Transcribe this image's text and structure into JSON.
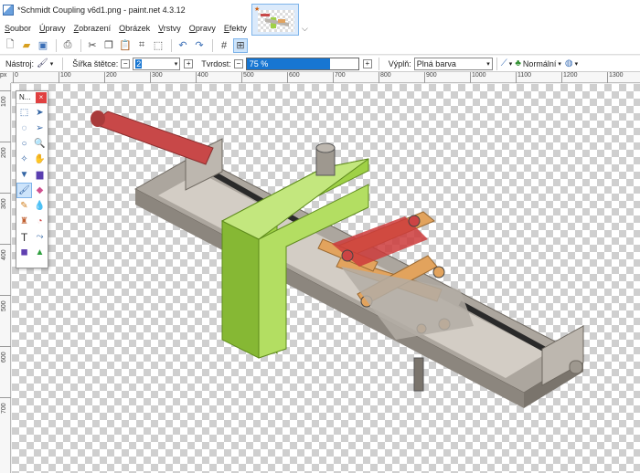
{
  "window": {
    "title": "*Schmidt Coupling v6d1.png - paint.net 4.3.12"
  },
  "menu": [
    {
      "label": "Soubor",
      "accel": "S",
      "rest": "oubor"
    },
    {
      "label": "Úpravy",
      "accel": "Ú",
      "rest": "pravy"
    },
    {
      "label": "Zobrazení",
      "accel": "Z",
      "rest": "obrazení"
    },
    {
      "label": "Obrázek",
      "accel": "O",
      "rest": "brázek"
    },
    {
      "label": "Vrstvy",
      "accel": "V",
      "rest": "rstvy"
    },
    {
      "label": "Opravy",
      "accel": "O",
      "rest": "pravy"
    },
    {
      "label": "Efekty",
      "accel": "E",
      "rest": "fekty"
    }
  ],
  "toolbar2": {
    "tool_label": "Nástroj:",
    "brush_width_label": "Šířka štětce:",
    "brush_width_value": "2",
    "hardness_label": "Tvrdost:",
    "hardness_value": "75 %",
    "hardness_fraction": 0.75,
    "fill_label": "Výplň:",
    "fill_value": "Plná barva",
    "blend_mode_value": "Normální"
  },
  "ruler": {
    "corner_unit": "px",
    "top_labels": [
      "0",
      "100",
      "200",
      "300",
      "400",
      "500",
      "600",
      "700",
      "800",
      "900",
      "1000",
      "1100",
      "1200",
      "1300"
    ],
    "left_labels": [
      "100",
      "200",
      "300",
      "400",
      "500",
      "600",
      "700"
    ]
  },
  "tools_panel": {
    "title": "N..."
  },
  "colors": {
    "green_part": "#9fd146",
    "red_handle": "#c84848",
    "metal": "#b9b3ab",
    "orange_link": "#e2a35d",
    "hardness_fill": "#1776d2"
  }
}
